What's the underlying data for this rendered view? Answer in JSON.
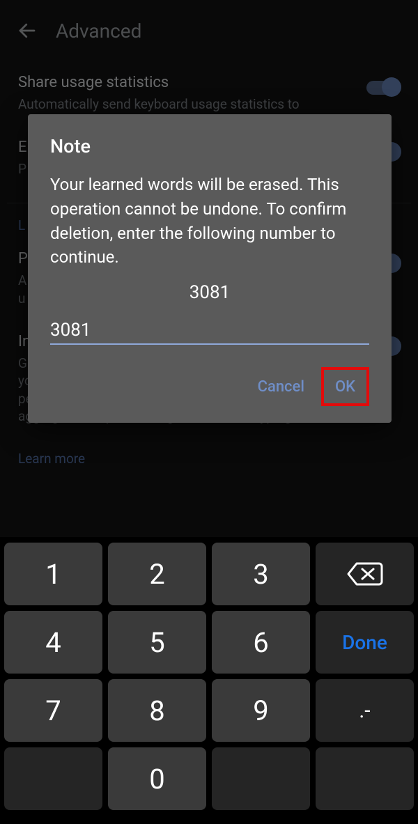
{
  "header": {
    "title": "Advanced"
  },
  "settings": {
    "share": {
      "title": "Share usage statistics",
      "sub": "Automatically send keyboard usage statistics to"
    },
    "row2": {
      "title": "E",
      "sub": "P"
    },
    "learned_link": "L",
    "personalization": {
      "title": "P",
      "sub_a": "A",
      "sub_b": "u"
    },
    "improve": {
      "title": "In",
      "sub": "G\nyour device based on your usage patterns. With your permission, Gboard will use these improvements, in the aggregate, to update Google's voice and typing services."
    },
    "learn_more": "Learn more"
  },
  "dialog": {
    "title": "Note",
    "body": "Your learned words will be erased. This operation cannot be undone. To confirm deletion, enter the following number to continue.",
    "number": "3081",
    "input_value": "3081",
    "cancel": "Cancel",
    "ok": "OK"
  },
  "keyboard": {
    "r1": [
      "1",
      "2",
      "3"
    ],
    "r2": [
      "4",
      "5",
      "6"
    ],
    "r3": [
      "7",
      "8",
      "9"
    ],
    "r4_mid": "0",
    "done": "Done",
    "sym": ".-"
  }
}
